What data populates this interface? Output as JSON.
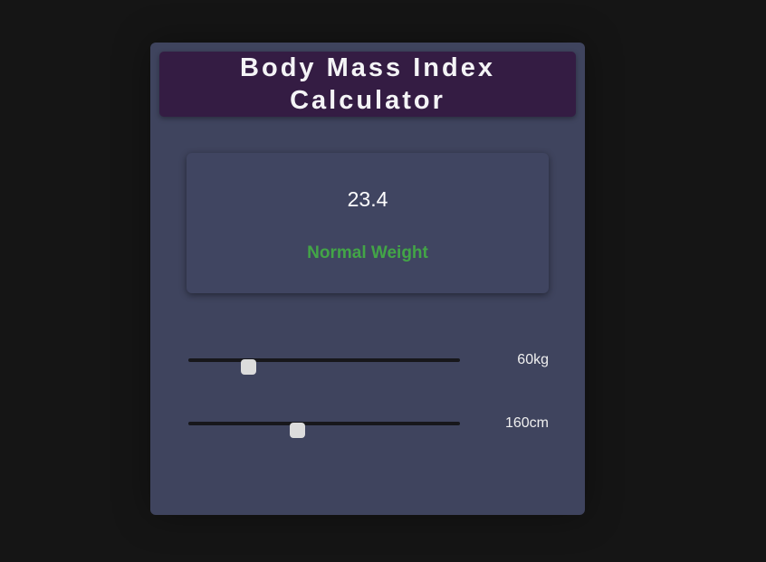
{
  "header": {
    "title": "Body Mass Index Calculator"
  },
  "result": {
    "bmi": "23.4",
    "status": "Normal Weight",
    "status_color": "#43a547"
  },
  "weight_slider": {
    "label": "60kg",
    "fraction": 0.22
  },
  "height_slider": {
    "label": "160cm",
    "fraction": 0.4
  },
  "colors": {
    "background": "#151515",
    "card": "#3f445e",
    "header": "#341c43",
    "thumb": "#dcdcdc"
  }
}
